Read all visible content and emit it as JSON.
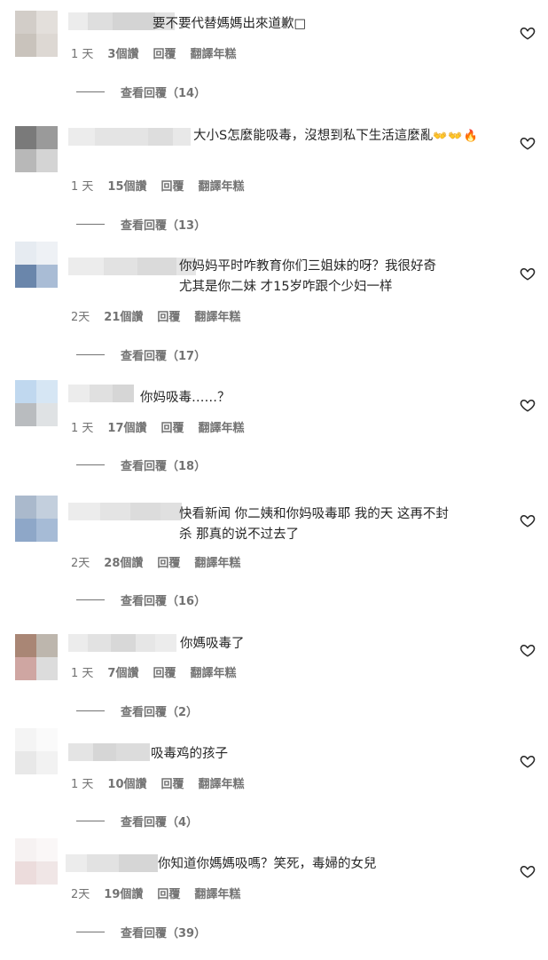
{
  "labels": {
    "reply": "回覆",
    "translate": "翻譯年糕"
  },
  "colors": {
    "text_primary": "#262626",
    "text_secondary": "#737373"
  },
  "comments": [
    {
      "text": "要不要代替媽媽出來道歉",
      "text_suffix": "□",
      "time": "1 天",
      "likes": "3個讚",
      "view_replies": "查看回覆（14）"
    },
    {
      "text": "大小S怎麼能吸毒，沒想到私下生活這麼亂",
      "emoji": "👐👐🔥",
      "time": "1 天",
      "likes": "15個讚",
      "view_replies": "查看回覆（13）"
    },
    {
      "text": "你妈妈平时咋教育你们三姐妹的呀？我很好奇\n尤其是你二妹 才15岁咋跟个少妇一样",
      "time": "2天",
      "likes": "21個讚",
      "view_replies": "查看回覆（17）"
    },
    {
      "text": "你妈吸毒……？",
      "time": "1 天",
      "likes": "17個讚",
      "view_replies": "查看回覆（18）"
    },
    {
      "text": "快看新闻 你二姨和你妈吸毒耶 我的天 这再不封\n杀 那真的说不过去了",
      "time": "2天",
      "likes": "28個讚",
      "view_replies": "查看回覆（16）"
    },
    {
      "text": "你媽吸毒了",
      "time": "1 天",
      "likes": "7個讚",
      "view_replies": "查看回覆（2）"
    },
    {
      "text": "吸毒鸡的孩子",
      "time": "1 天",
      "likes": "10個讚",
      "view_replies": "查看回覆（4）"
    },
    {
      "text": "你知道你媽媽吸嗎？笑死，毒婦的女兒",
      "time": "2天",
      "likes": "19個讚",
      "view_replies": "查看回覆（39）"
    }
  ]
}
